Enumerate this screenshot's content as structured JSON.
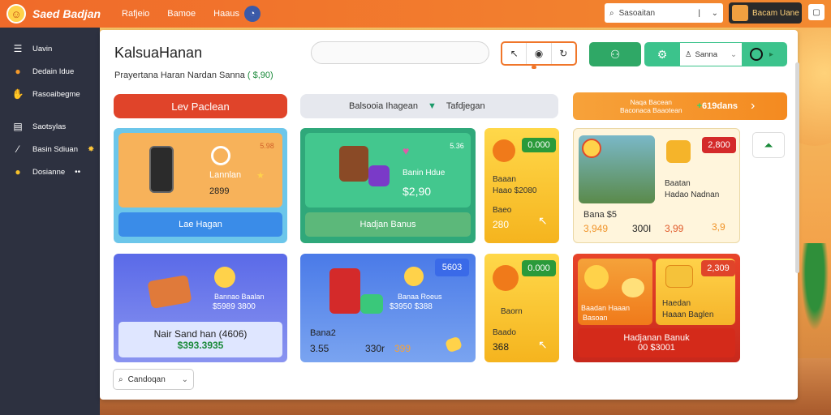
{
  "topbar": {
    "title": "Saed Badjan",
    "nav": [
      "Rafjeio",
      "Bamoe",
      "Haaus"
    ],
    "search_placeholder": "Sasoaitan",
    "user_label": "Bacam Uane"
  },
  "sidebar": {
    "items": [
      {
        "label": "Uavin",
        "icon": "list-icon"
      },
      {
        "label": "Dedain Idue",
        "icon": "fire-icon"
      },
      {
        "label": "Rasoaibegme",
        "icon": "hand-icon"
      },
      {
        "label": "Saotsylas",
        "icon": "chart-icon"
      },
      {
        "label": "Basin Sdiuan",
        "icon": "wand-icon"
      },
      {
        "label": "Dosianne",
        "icon": "coin-icon"
      }
    ]
  },
  "main": {
    "title": "KalsuaHanan",
    "subtitle": "Prayertana Haran Nardan Sanna",
    "subtitle_amount": "( $,90)",
    "teal_select": "Sanna",
    "red_pill": "Lev Paclean",
    "gray_pill": "Balsooia Ihagean",
    "gray_pill_right": "Tafdjegan",
    "orange_pill_text_1": "Naqa Bacean",
    "orange_pill_text_2": "Baconaca Baaotean",
    "orange_pill_amount": "619dans",
    "filter": "Candoqan"
  },
  "cards": {
    "c1": {
      "price": "5.98",
      "title": "Lannlan",
      "value": "2899",
      "button": "Lae Hagan"
    },
    "c2": {
      "price": "5.36",
      "title": "Banin Hdue",
      "value": "$2,90",
      "button": "Hadjan Banus"
    },
    "c3": {
      "price": "0.000",
      "line1": "Baaan",
      "line2": "Haao $2080",
      "line3": "Baeo",
      "value": "280"
    },
    "c4": {
      "price": "2,800",
      "line1": "Bana $5",
      "value1": "3,949",
      "value2": "300I",
      "line2": "Baatan",
      "line3": "Hadao Nadnan",
      "value3": "3,99",
      "value4": "3,9"
    },
    "c5": {
      "line1": "Bannao Baalan",
      "line2": "$5989 3800",
      "title": "Nair Sand han (4606)",
      "value": "$393.3935"
    },
    "c6": {
      "price": "5603",
      "line1": "Banaa Roeus",
      "line2": "$3950 $388",
      "label": "Bana2",
      "value1": "3.55",
      "value2": "330r",
      "value3": "399"
    },
    "c7": {
      "price": "0.000",
      "line1": "Baorn",
      "line2": "Baado",
      "value": "368"
    },
    "c8": {
      "price": "2,309",
      "line1": "Baadan Haaan",
      "line2": "Haedan",
      "line3": "Basoan",
      "line4": "Haaan Baglen",
      "button": "Hadjanan Banuk",
      "button_value": "00 $3001"
    }
  },
  "colors": {
    "topbar": "#f06a2a",
    "sidebar": "#2d3140",
    "accent_red": "#e0442a",
    "accent_green": "#2fa866",
    "accent_orange": "#f48a20"
  }
}
